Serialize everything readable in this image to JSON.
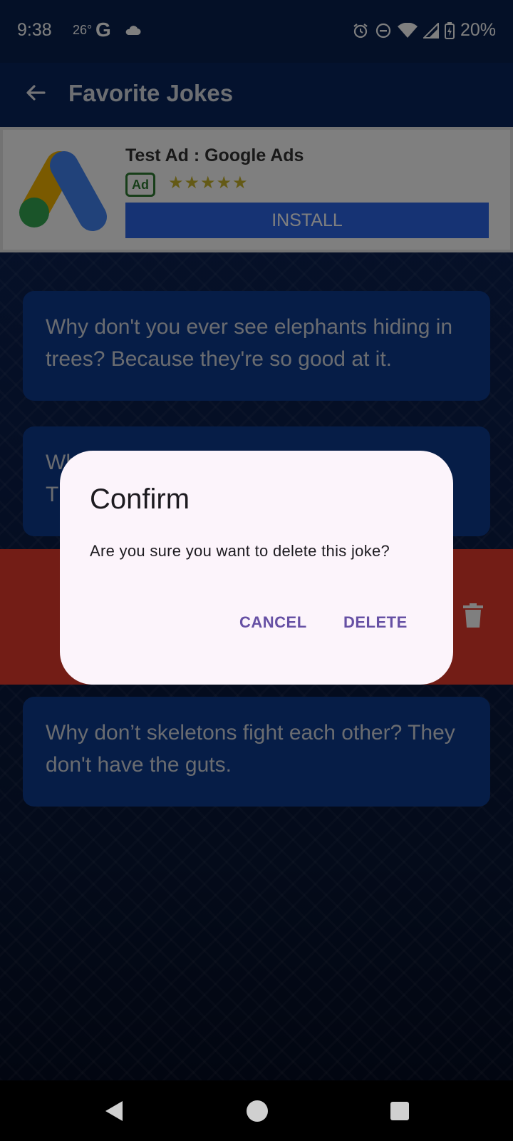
{
  "status_bar": {
    "time": "9:38",
    "temperature": "26°",
    "google_letter": "G",
    "battery": "20%",
    "icons": [
      "cloud-icon",
      "alarm-icon",
      "dnd-icon",
      "wifi-icon",
      "signal-icon",
      "battery-icon"
    ]
  },
  "app_bar": {
    "title": "Favorite Jokes",
    "back_icon": "back-arrow-icon"
  },
  "ad": {
    "title": "Test Ad : Google Ads",
    "badge": "Ad",
    "stars": "★★★★★",
    "rating_stars": 4.5,
    "install_label": "INSTALL"
  },
  "jokes": [
    {
      "text": "Why don't you ever see elephants hiding in trees? Because they're so good at it."
    },
    {
      "text": "Wh\nT"
    },
    {
      "text": "Why don’t skeletons fight each other? They don't have the guts."
    }
  ],
  "dialog": {
    "title": "Confirm",
    "message": "Are you sure you want to delete this joke?",
    "cancel_label": "CANCEL",
    "delete_label": "DELETE"
  },
  "colors": {
    "app_bar": "#08255c",
    "card": "#0c3a8f",
    "delete_strip": "#e63a2c",
    "dialog_bg": "#fcf4fb",
    "dialog_accent": "#6650a4"
  }
}
